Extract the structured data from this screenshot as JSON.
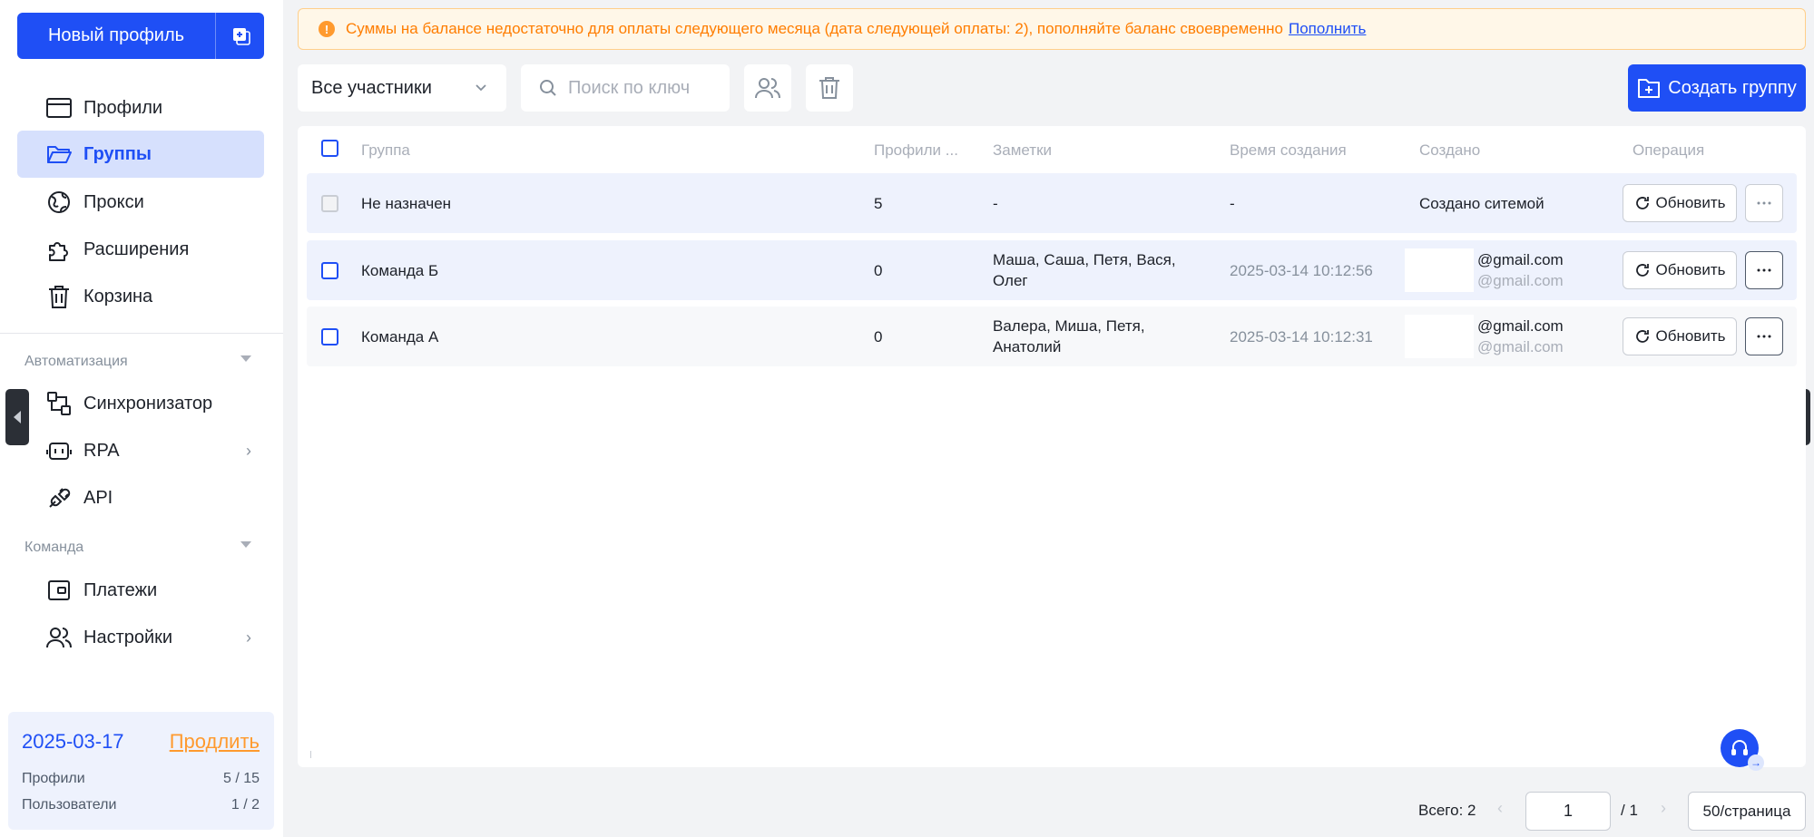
{
  "colors": {
    "accent": "#1f4ff5",
    "warning": "#ff9a2e",
    "active_bg": "#d6e0fd"
  },
  "sidebar": {
    "new_profile_label": "Новый профиль",
    "items": [
      {
        "label": "Профили",
        "icon": "browser-window-icon"
      },
      {
        "label": "Группы",
        "icon": "folder-open-icon",
        "active": true
      },
      {
        "label": "Прокси",
        "icon": "globe-icon"
      },
      {
        "label": "Расширения",
        "icon": "puzzle-icon"
      },
      {
        "label": "Корзина",
        "icon": "trash-icon"
      }
    ],
    "automation_title": "Автоматизация",
    "automation_items": [
      {
        "label": "Синхронизатор",
        "icon": "sync-icon"
      },
      {
        "label": "RPA",
        "icon": "robot-icon"
      },
      {
        "label": "API",
        "icon": "plug-icon"
      }
    ],
    "team_title": "Команда",
    "team_items": [
      {
        "label": "Платежи",
        "icon": "wallet-icon"
      },
      {
        "label": "Настройки",
        "icon": "users-icon"
      }
    ],
    "plan": {
      "date": "2025-03-17",
      "extend_label": "Продлить",
      "profiles_label": "Профили",
      "profiles_value": "5 / 15",
      "users_label": "Пользователи",
      "users_value": "1 / 2"
    }
  },
  "alert": {
    "text": "Суммы на балансе недостаточно для оплаты следующего месяца (дата следующей оплаты: 2), пополняйте баланс своевременно",
    "link": "Пополнить"
  },
  "toolbar": {
    "members_select": "Все участники",
    "search_placeholder": "Поиск по ключ",
    "create_group_label": "Создать группу"
  },
  "table": {
    "headers": {
      "group": "Группа",
      "profiles": "Профили ...",
      "notes": "Заметки",
      "created_time": "Время создания",
      "created_by": "Создано",
      "operation": "Операция"
    },
    "rows": [
      {
        "group": "Не назначен",
        "profiles": "5",
        "notes_1": "-",
        "notes_2": "",
        "created_time": "-",
        "created_by_1": "Создано ситемой",
        "created_by_2": "",
        "update": "Обновить"
      },
      {
        "group": "Команда Б",
        "profiles": "0",
        "notes_1": "Маша, Саша, Петя, Вася,",
        "notes_2": "Олег",
        "created_time": "2025-03-14 10:12:56",
        "created_by_1": "@gmail.com",
        "created_by_2": "@gmail.com",
        "update": "Обновить"
      },
      {
        "group": "Команда А",
        "profiles": "0",
        "notes_1": "Валера, Миша, Петя,",
        "notes_2": "Анатолий",
        "created_time": "2025-03-14 10:12:31",
        "created_by_1": "@gmail.com",
        "created_by_2": "@gmail.com",
        "update": "Обновить"
      }
    ]
  },
  "pagination": {
    "total": "Всего: 2",
    "current_page": "1",
    "of_pages": "/ 1",
    "page_size": "50/страница"
  }
}
